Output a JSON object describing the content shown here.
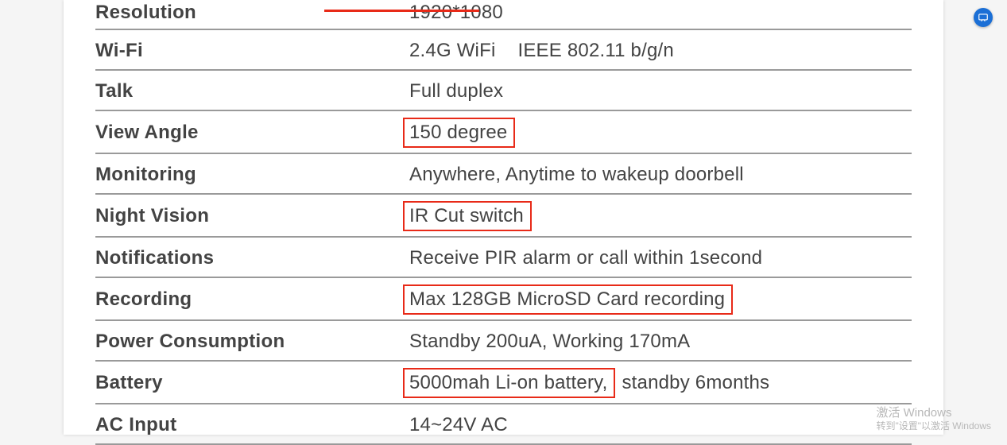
{
  "specs": [
    {
      "label": "Resolution",
      "value": "1920*1080",
      "highlight": false
    },
    {
      "label": "Wi-Fi",
      "value": "2.4G WiFi",
      "extra": "IEEE 802.11 b/g/n",
      "highlight": false
    },
    {
      "label": "Talk",
      "value": "Full duplex",
      "highlight": false
    },
    {
      "label": "View Angle",
      "value": "150 degree",
      "highlight": true
    },
    {
      "label": "Monitoring",
      "value": "Anywhere, Anytime to wakeup doorbell",
      "highlight": false
    },
    {
      "label": "Night Vision",
      "value": "IR Cut switch",
      "highlight": true
    },
    {
      "label": "Notifications",
      "value": "Receive PIR alarm or call within 1second",
      "highlight": false
    },
    {
      "label": "Recording",
      "value": "Max 128GB MicroSD Card recording",
      "highlight": true
    },
    {
      "label": "Power Consumption",
      "value": "Standby 200uA, Working 170mA",
      "highlight": false
    },
    {
      "label": "Battery",
      "value": "5000mah Li-on battery,",
      "suffix": "standby 6months",
      "highlight": true
    },
    {
      "label": "AC Input",
      "value": "14~24V AC",
      "highlight": false
    }
  ],
  "watermark": {
    "line1": "激活 Windows",
    "line2": "转到\"设置\"以激活 Windows"
  }
}
